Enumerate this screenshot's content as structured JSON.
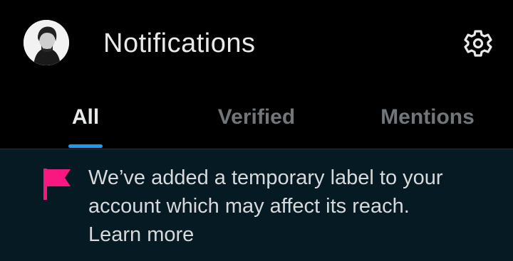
{
  "header": {
    "title": "Notifications",
    "avatar_icon": "user-avatar-icon",
    "settings_icon": "gear-icon"
  },
  "tabs": [
    {
      "label": "All",
      "active": true
    },
    {
      "label": "Verified",
      "active": false
    },
    {
      "label": "Mentions",
      "active": false
    }
  ],
  "banner": {
    "icon": "flag-icon",
    "message": "We’ve added a temporary label to your account which may affect its reach.",
    "link_label": "Learn more"
  },
  "colors": {
    "background": "#000000",
    "banner_background": "#061a24",
    "accent": "#1d9bf0",
    "flag": "#f91880",
    "text_primary": "#e7e9ea",
    "text_secondary": "#71767b"
  }
}
